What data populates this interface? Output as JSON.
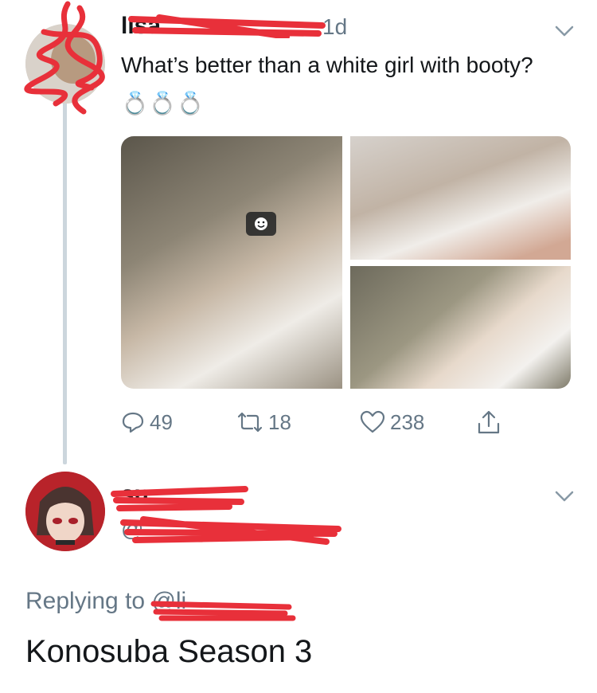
{
  "tweet": {
    "author_name": "lisa",
    "time": "1d",
    "text": "What’s better than a white girl with booty? 💍💍💍",
    "stats": {
      "replies": "49",
      "retweets": "18",
      "likes": "238"
    }
  },
  "reply": {
    "author_name": "su",
    "handle": "@",
    "replying_to_label": "Replying to",
    "replying_to_handle": "@li",
    "text": "Konosuba Season 3"
  },
  "colors": {
    "text": "#14171a",
    "secondary": "#657786",
    "thread_line": "#ccd6dd",
    "redaction": "#e8303a"
  },
  "icons": [
    "chevron-down-icon",
    "reply-icon",
    "retweet-icon",
    "like-icon",
    "share-icon",
    "sticker-icon"
  ]
}
